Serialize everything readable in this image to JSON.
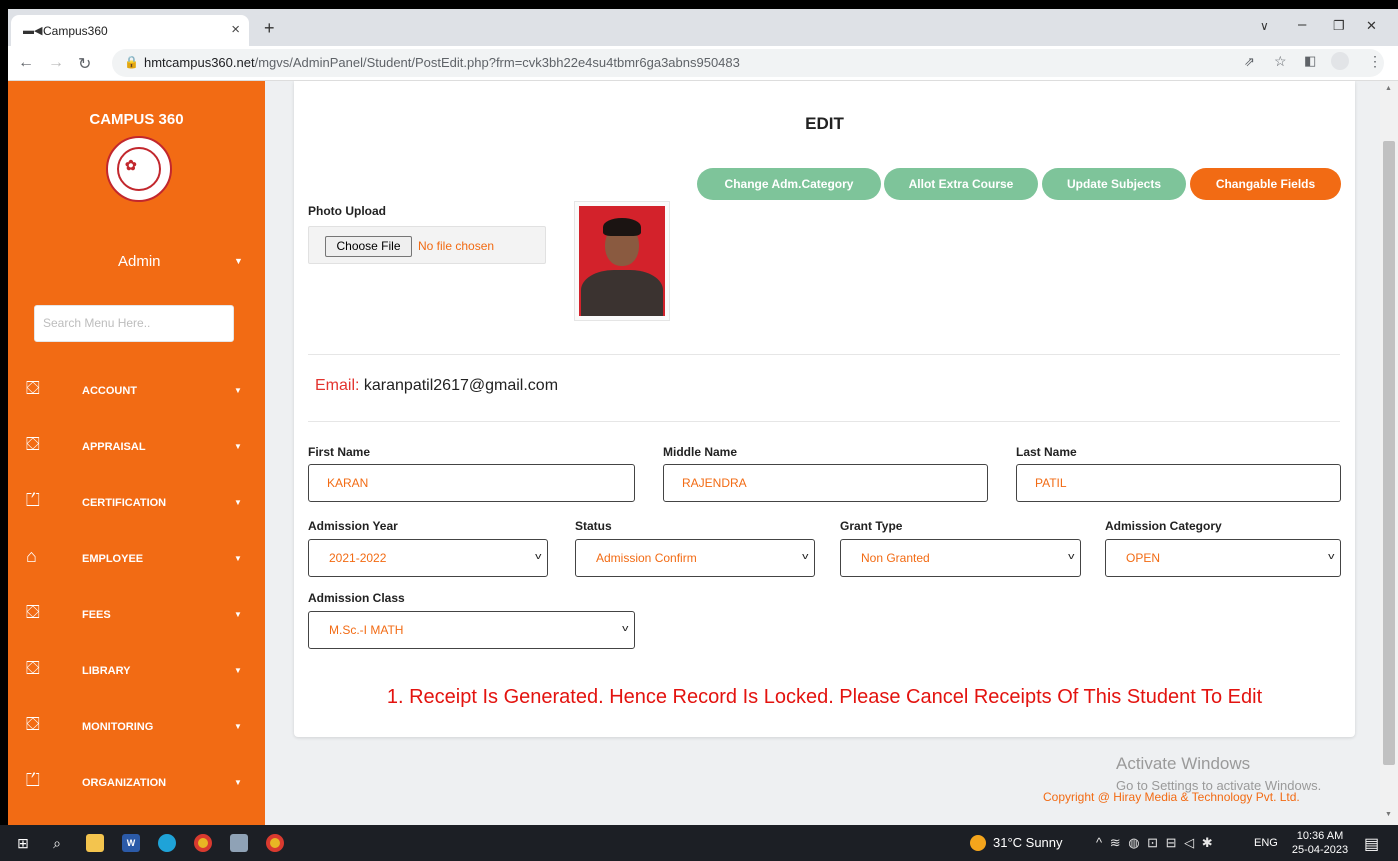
{
  "browser": {
    "tab_title": "Campus360",
    "tab_close": "×",
    "new_tab": "+",
    "url_host": "hmtcampus360.net",
    "url_path": "/mgvs/AdminPanel/Student/PostEdit.php?frm=cvk3bh22e4su4tbmr6ga3abns950483",
    "controls": {
      "dropdown": "∨",
      "minimize": "–",
      "restore": "❐",
      "close": "✕"
    }
  },
  "sidebar": {
    "brand": "CAMPUS 360",
    "logo_mark": "✿",
    "user": "Admin",
    "search_placeholder": "Search Menu Here..",
    "items": [
      {
        "label": "ACCOUNT",
        "icon": "briefcase-icon"
      },
      {
        "label": "APPRAISAL",
        "icon": "briefcase-icon"
      },
      {
        "label": "CERTIFICATION",
        "icon": "certificate-icon"
      },
      {
        "label": "EMPLOYEE",
        "icon": "home-icon"
      },
      {
        "label": "FEES",
        "icon": "briefcase-icon"
      },
      {
        "label": "LIBRARY",
        "icon": "briefcase-icon"
      },
      {
        "label": "MONITORING",
        "icon": "briefcase-icon"
      },
      {
        "label": "ORGANIZATION",
        "icon": "certificate-icon"
      }
    ]
  },
  "main": {
    "title": "EDIT",
    "actions": {
      "change_category": "Change Adm.Category",
      "allot_course": "Allot Extra Course",
      "update_subjects": "Update Subjects",
      "changable_fields": "Changable Fields"
    },
    "photo_upload_label": "Photo Upload",
    "choose_file": "Choose File",
    "no_file": "No file chosen",
    "email_label": "Email:",
    "email_value": "karanpatil2617@gmail.com",
    "fields": {
      "first_name_label": "First Name",
      "first_name": "KARAN",
      "middle_name_label": "Middle Name",
      "middle_name": "RAJENDRA",
      "last_name_label": "Last Name",
      "last_name": "PATIL",
      "admission_year_label": "Admission Year",
      "admission_year": "2021-2022",
      "status_label": "Status",
      "status": "Admission Confirm",
      "grant_type_label": "Grant Type",
      "grant_type": "Non Granted",
      "admission_category_label": "Admission Category",
      "admission_category": "OPEN",
      "admission_class_label": "Admission Class",
      "admission_class": "M.Sc.-I MATH"
    },
    "locked_message": "1. Receipt Is Generated. Hence Record Is Locked. Please Cancel Receipts Of This Student To Edit"
  },
  "footer": {
    "activate_title": "Activate Windows",
    "activate_sub": "Go to Settings to activate Windows.",
    "copyright": "Copyright @ Hiray Media & Technology Pvt. Ltd."
  },
  "taskbar": {
    "weather": "31°C  Sunny",
    "lang": "ENG",
    "time": "10:36 AM",
    "date": "25-04-2023"
  },
  "colors": {
    "accent": "#f26b14",
    "green_button": "#7ec49a",
    "error": "#e3130f"
  }
}
